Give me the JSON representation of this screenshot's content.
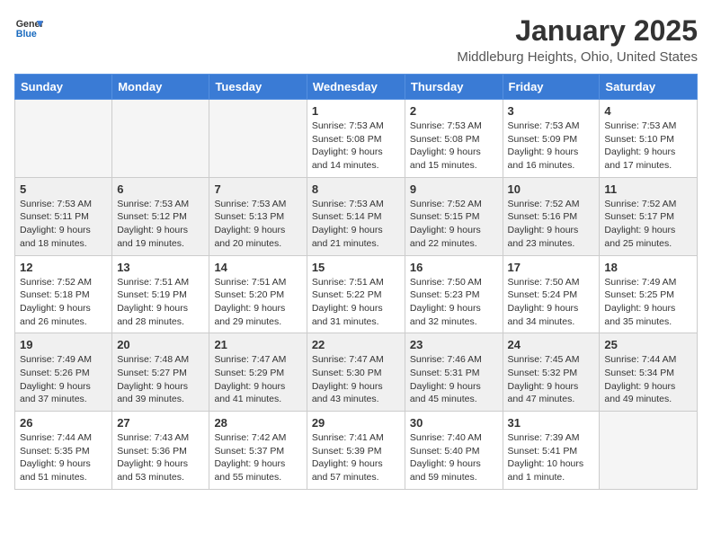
{
  "logo": {
    "general": "General",
    "blue": "Blue"
  },
  "title": "January 2025",
  "location": "Middleburg Heights, Ohio, United States",
  "headers": [
    "Sunday",
    "Monday",
    "Tuesday",
    "Wednesday",
    "Thursday",
    "Friday",
    "Saturday"
  ],
  "weeks": [
    [
      {
        "day": "",
        "info": ""
      },
      {
        "day": "",
        "info": ""
      },
      {
        "day": "",
        "info": ""
      },
      {
        "day": "1",
        "info": "Sunrise: 7:53 AM\nSunset: 5:08 PM\nDaylight: 9 hours\nand 14 minutes."
      },
      {
        "day": "2",
        "info": "Sunrise: 7:53 AM\nSunset: 5:08 PM\nDaylight: 9 hours\nand 15 minutes."
      },
      {
        "day": "3",
        "info": "Sunrise: 7:53 AM\nSunset: 5:09 PM\nDaylight: 9 hours\nand 16 minutes."
      },
      {
        "day": "4",
        "info": "Sunrise: 7:53 AM\nSunset: 5:10 PM\nDaylight: 9 hours\nand 17 minutes."
      }
    ],
    [
      {
        "day": "5",
        "info": "Sunrise: 7:53 AM\nSunset: 5:11 PM\nDaylight: 9 hours\nand 18 minutes."
      },
      {
        "day": "6",
        "info": "Sunrise: 7:53 AM\nSunset: 5:12 PM\nDaylight: 9 hours\nand 19 minutes."
      },
      {
        "day": "7",
        "info": "Sunrise: 7:53 AM\nSunset: 5:13 PM\nDaylight: 9 hours\nand 20 minutes."
      },
      {
        "day": "8",
        "info": "Sunrise: 7:53 AM\nSunset: 5:14 PM\nDaylight: 9 hours\nand 21 minutes."
      },
      {
        "day": "9",
        "info": "Sunrise: 7:52 AM\nSunset: 5:15 PM\nDaylight: 9 hours\nand 22 minutes."
      },
      {
        "day": "10",
        "info": "Sunrise: 7:52 AM\nSunset: 5:16 PM\nDaylight: 9 hours\nand 23 minutes."
      },
      {
        "day": "11",
        "info": "Sunrise: 7:52 AM\nSunset: 5:17 PM\nDaylight: 9 hours\nand 25 minutes."
      }
    ],
    [
      {
        "day": "12",
        "info": "Sunrise: 7:52 AM\nSunset: 5:18 PM\nDaylight: 9 hours\nand 26 minutes."
      },
      {
        "day": "13",
        "info": "Sunrise: 7:51 AM\nSunset: 5:19 PM\nDaylight: 9 hours\nand 28 minutes."
      },
      {
        "day": "14",
        "info": "Sunrise: 7:51 AM\nSunset: 5:20 PM\nDaylight: 9 hours\nand 29 minutes."
      },
      {
        "day": "15",
        "info": "Sunrise: 7:51 AM\nSunset: 5:22 PM\nDaylight: 9 hours\nand 31 minutes."
      },
      {
        "day": "16",
        "info": "Sunrise: 7:50 AM\nSunset: 5:23 PM\nDaylight: 9 hours\nand 32 minutes."
      },
      {
        "day": "17",
        "info": "Sunrise: 7:50 AM\nSunset: 5:24 PM\nDaylight: 9 hours\nand 34 minutes."
      },
      {
        "day": "18",
        "info": "Sunrise: 7:49 AM\nSunset: 5:25 PM\nDaylight: 9 hours\nand 35 minutes."
      }
    ],
    [
      {
        "day": "19",
        "info": "Sunrise: 7:49 AM\nSunset: 5:26 PM\nDaylight: 9 hours\nand 37 minutes."
      },
      {
        "day": "20",
        "info": "Sunrise: 7:48 AM\nSunset: 5:27 PM\nDaylight: 9 hours\nand 39 minutes."
      },
      {
        "day": "21",
        "info": "Sunrise: 7:47 AM\nSunset: 5:29 PM\nDaylight: 9 hours\nand 41 minutes."
      },
      {
        "day": "22",
        "info": "Sunrise: 7:47 AM\nSunset: 5:30 PM\nDaylight: 9 hours\nand 43 minutes."
      },
      {
        "day": "23",
        "info": "Sunrise: 7:46 AM\nSunset: 5:31 PM\nDaylight: 9 hours\nand 45 minutes."
      },
      {
        "day": "24",
        "info": "Sunrise: 7:45 AM\nSunset: 5:32 PM\nDaylight: 9 hours\nand 47 minutes."
      },
      {
        "day": "25",
        "info": "Sunrise: 7:44 AM\nSunset: 5:34 PM\nDaylight: 9 hours\nand 49 minutes."
      }
    ],
    [
      {
        "day": "26",
        "info": "Sunrise: 7:44 AM\nSunset: 5:35 PM\nDaylight: 9 hours\nand 51 minutes."
      },
      {
        "day": "27",
        "info": "Sunrise: 7:43 AM\nSunset: 5:36 PM\nDaylight: 9 hours\nand 53 minutes."
      },
      {
        "day": "28",
        "info": "Sunrise: 7:42 AM\nSunset: 5:37 PM\nDaylight: 9 hours\nand 55 minutes."
      },
      {
        "day": "29",
        "info": "Sunrise: 7:41 AM\nSunset: 5:39 PM\nDaylight: 9 hours\nand 57 minutes."
      },
      {
        "day": "30",
        "info": "Sunrise: 7:40 AM\nSunset: 5:40 PM\nDaylight: 9 hours\nand 59 minutes."
      },
      {
        "day": "31",
        "info": "Sunrise: 7:39 AM\nSunset: 5:41 PM\nDaylight: 10 hours\nand 1 minute."
      },
      {
        "day": "",
        "info": ""
      }
    ]
  ]
}
